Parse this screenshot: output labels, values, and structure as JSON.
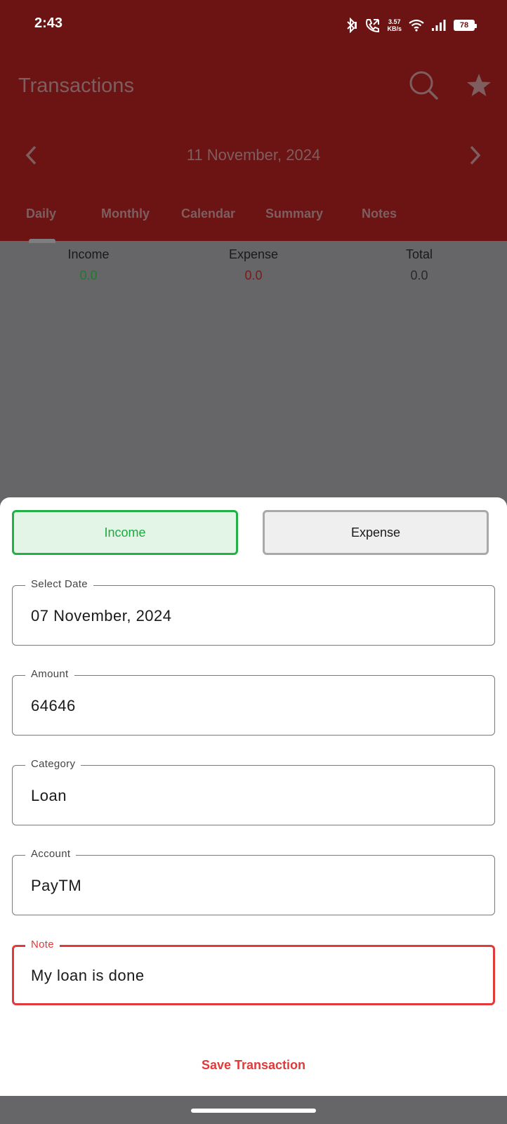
{
  "status_bar": {
    "time": "2:43",
    "net_speed_top": "3.57",
    "net_speed_bottom": "KB/s",
    "battery": "78"
  },
  "header": {
    "title": "Transactions",
    "search_icon": "search-icon",
    "favorite_icon": "star-icon",
    "date": "11 November, 2024"
  },
  "tabs": [
    {
      "label": "Daily"
    },
    {
      "label": "Monthly"
    },
    {
      "label": "Calendar"
    },
    {
      "label": "Summary"
    },
    {
      "label": "Notes"
    }
  ],
  "summary": {
    "income_label": "Income",
    "income_value": "0.0",
    "expense_label": "Expense",
    "expense_value": "0.0",
    "total_label": "Total",
    "total_value": "0.0"
  },
  "sheet": {
    "income_button": "Income",
    "expense_button": "Expense",
    "fields": [
      {
        "label": "Select Date",
        "value": "07 November, 2024"
      },
      {
        "label": "Amount",
        "value": "64646"
      },
      {
        "label": "Category",
        "value": "Loan"
      },
      {
        "label": "Account",
        "value": "PayTM"
      },
      {
        "label": "Note",
        "value": "My loan is done"
      }
    ],
    "save_label": "Save Transaction"
  },
  "colors": {
    "header_bg": "#6c1313",
    "scrim": "#666567",
    "income_green": "#1aaa3f",
    "expense_red": "#e03a3a"
  }
}
